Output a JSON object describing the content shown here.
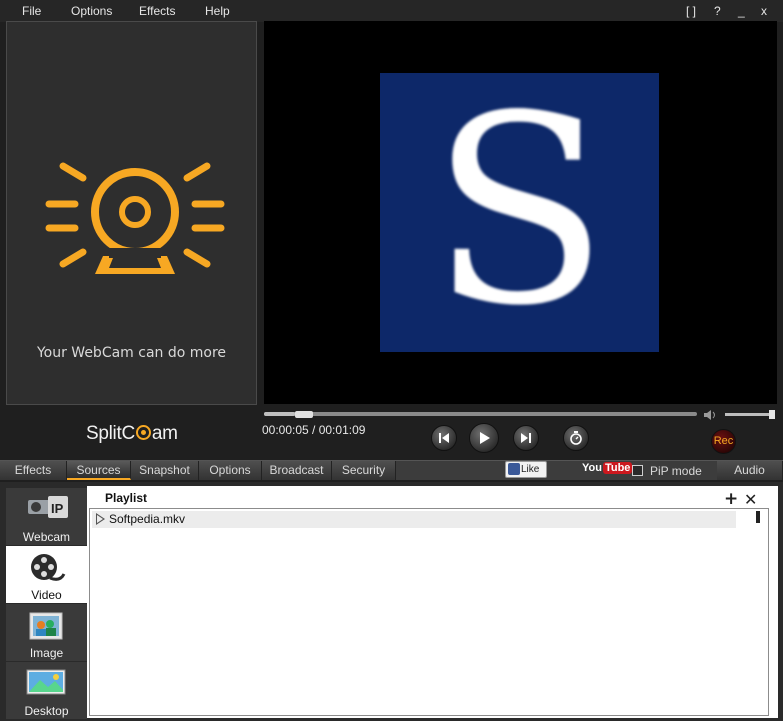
{
  "menu": {
    "items": [
      "File",
      "Options",
      "Effects",
      "Help"
    ],
    "window_controls": [
      "[ ]",
      "?",
      "_",
      "x"
    ]
  },
  "promo": {
    "text": "Your WebCam can do more",
    "icon": "webcam-rays-icon",
    "icon_color": "#f7a823"
  },
  "preview": {
    "logo_letter": "S",
    "logo_bg": "#0d2869"
  },
  "player": {
    "timecode": "00:00:05 / 00:01:09",
    "progress": 0.072,
    "volume": 0.9,
    "rec_label": "Rec"
  },
  "brand": {
    "split": "Split",
    "c": "C",
    "am": "am"
  },
  "tabs": [
    {
      "label": "Effects",
      "active": false
    },
    {
      "label": "Sources",
      "active": true
    },
    {
      "label": "Snapshot",
      "active": false
    },
    {
      "label": "Options",
      "active": false
    },
    {
      "label": "Broadcast",
      "active": false
    },
    {
      "label": "Security",
      "active": false
    }
  ],
  "toolbar": {
    "like_label": "Like",
    "youtube_you": "You",
    "youtube_tube": "Tube",
    "pip_label": "PiP mode",
    "audio_label": "Audio"
  },
  "sources": [
    {
      "label": "Webcam",
      "icon": "ip-camera-icon",
      "active": false
    },
    {
      "label": "Video",
      "icon": "film-reel-icon",
      "active": true
    },
    {
      "label": "Image",
      "icon": "picture-icon",
      "active": false
    },
    {
      "label": "Desktop",
      "icon": "desktop-icon",
      "active": false
    }
  ],
  "playlist": {
    "title": "Playlist",
    "add_symbol": "+",
    "close_symbol": "✕",
    "items": [
      "Softpedia.mkv"
    ]
  },
  "colors": {
    "accent": "#f7a823",
    "background": "#1f1f1f"
  }
}
